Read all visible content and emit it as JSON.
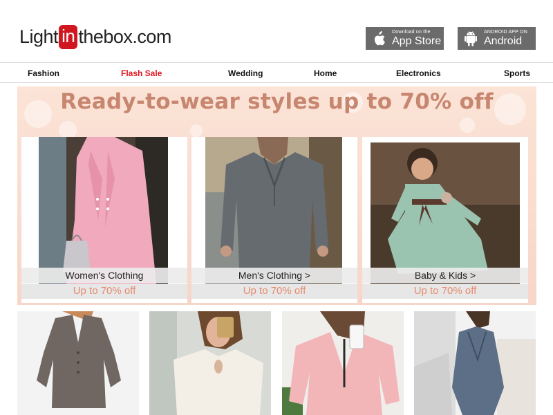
{
  "header": {
    "logo": {
      "part1": "Light",
      "part2": "in",
      "part3": "thebox",
      "part4": ".com"
    },
    "app_store": {
      "small": "Download on the",
      "big": "App Store"
    },
    "android": {
      "small": "ANDROID APP ON",
      "big": "Android"
    }
  },
  "nav": {
    "items": [
      "Fashion",
      "Flash Sale",
      "Wedding",
      "Home",
      "Electronics",
      "Sports"
    ]
  },
  "banner": {
    "title": "Ready-to-wear styles up to 70% off",
    "cards": [
      {
        "caption": "Women's Clothing",
        "sale": "Up to 70% off"
      },
      {
        "caption": "Men's Clothing >",
        "sale": "Up to 70% off"
      },
      {
        "caption": "Baby & Kids >",
        "sale": "Up to 70% off"
      }
    ]
  },
  "colors": {
    "brand_red": "#d0161e",
    "flash_sale": "#e0141e",
    "banner_title": "#c7866f",
    "sale_text": "#e78a6e"
  }
}
